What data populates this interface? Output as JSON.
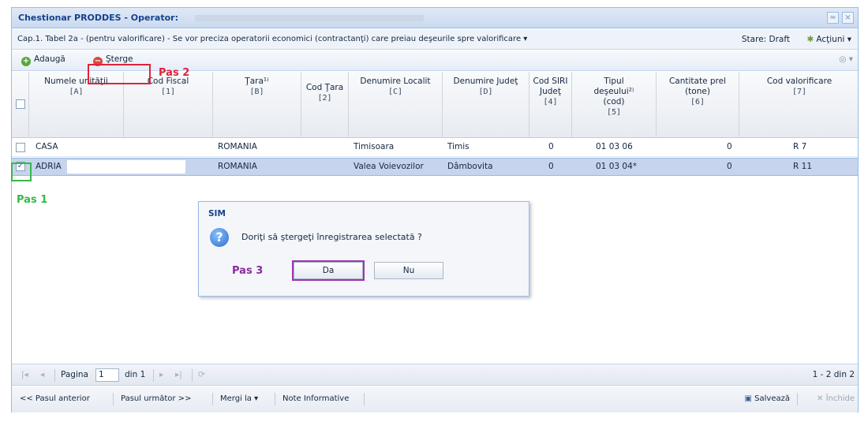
{
  "window": {
    "title": "Chestionar PRODDES - Operator:",
    "buttons": [
      "≈",
      "×"
    ]
  },
  "subheader": {
    "caption": "Cap.1. Tabel 2a - (pentru valorificare) - Se vor preciza operatorii economici (contractanţi) care preiau deşeurile spre valorificare ▾",
    "stare": "Stare: Draft",
    "actiuni": "Acţiuni ▾"
  },
  "toolbar": {
    "add_label": "Adaugă",
    "delete_label": "Şterge",
    "settings": "◎ ▾"
  },
  "steps": {
    "pas1": "Pas 1",
    "pas2": "Pas 2",
    "pas3": "Pas 3"
  },
  "grid": {
    "columns": [
      {
        "title": "Numele unităţii",
        "code": "[A]"
      },
      {
        "title": "Cod Fiscal",
        "code": "[1]"
      },
      {
        "title": "Ţara¹⁾",
        "code": "[B]"
      },
      {
        "title": "Cod Ţara",
        "code": "[2]"
      },
      {
        "title": "Denumire Localit",
        "code": "[C]"
      },
      {
        "title": "Denumire Judeţ",
        "code": "[D]"
      },
      {
        "title": "Cod SIRI Judeţ",
        "code": "[4]"
      },
      {
        "title": "Tipul deşeului²⁾ (cod)",
        "code": "[5]"
      },
      {
        "title": "Cantitate prel (tone)",
        "code": "[6]"
      },
      {
        "title": "Cod valorificare",
        "code": "[7]"
      }
    ],
    "rows": [
      {
        "checked": false,
        "name": "CASA",
        "tara": "ROMANIA",
        "localitate": "Timisoara",
        "judet": "Timis",
        "siruta": "0",
        "tip": "01 03 06",
        "cantitate": "0",
        "cod_val": "R 7"
      },
      {
        "checked": true,
        "name": "ADRIA",
        "tara": "ROMANIA",
        "localitate": "Valea Voievozilor",
        "judet": "Dâmbovita",
        "siruta": "0",
        "tip": "01 03 04*",
        "cantitate": "0",
        "cod_val": "R 11"
      }
    ]
  },
  "dialog": {
    "title": "SIM",
    "message": "Doriţi să ştergeţi înregistrarea selectată ?",
    "yes": "Da",
    "no": "Nu"
  },
  "pager": {
    "page_label": "Pagina",
    "page_value": "1",
    "of_label": "din 1",
    "summary": "1 - 2 din 2"
  },
  "footer": {
    "prev": "<< Pasul anterior",
    "next": "Pasul următor >>",
    "goto": "Mergi la ▾",
    "notes": "Note Informative",
    "save": "Salvează",
    "close": "Închide"
  }
}
